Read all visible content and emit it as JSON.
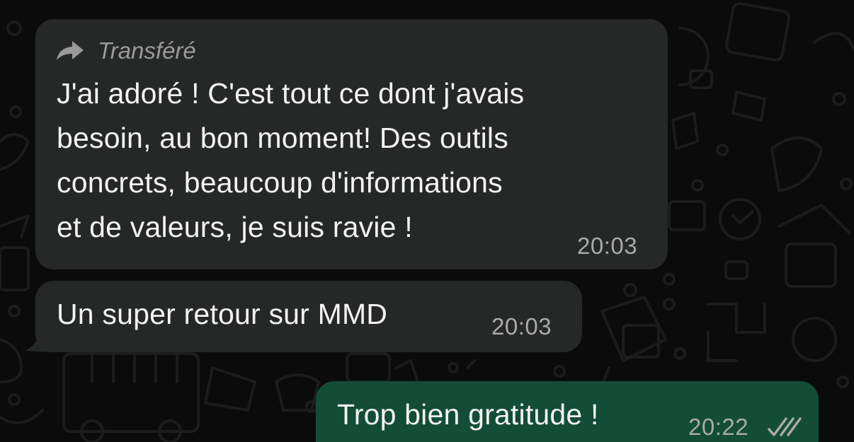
{
  "messages": [
    {
      "direction": "incoming",
      "forwarded_label": "Transféré",
      "text": "J'ai adoré ! C'est tout ce dont j'avais\nbesoin, au bon moment! Des outils\nconcrets, beaucoup d'informations\net de valeurs, je suis ravie !",
      "time": "20:03"
    },
    {
      "direction": "incoming",
      "text": "Un super retour sur MMD",
      "time": "20:03"
    },
    {
      "direction": "outgoing",
      "text": "Trop bien gratitude !",
      "time": "20:22",
      "status_icon": "double-check-icon"
    }
  ],
  "colors": {
    "background": "#0b0b0b",
    "incoming_bubble": "#262727",
    "outgoing_bubble": "#134d37",
    "timestamp": "#a9aaa9",
    "forward_label": "#9a9a9a"
  },
  "icons": {
    "forward": "forward-arrow-icon",
    "read_receipt": "double-check-icon"
  }
}
